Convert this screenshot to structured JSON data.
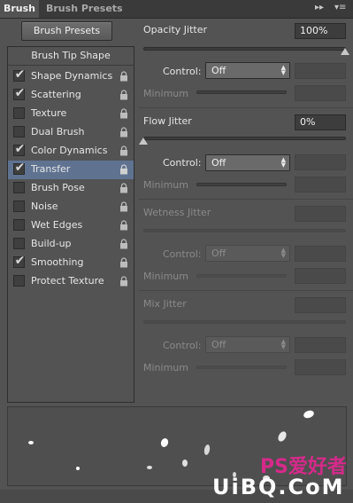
{
  "tabs": [
    {
      "label": "Brush",
      "active": true
    },
    {
      "label": "Brush Presets",
      "active": false
    }
  ],
  "tab_controls": {
    "collapse": "▸▸",
    "menu": "▾≡"
  },
  "brush_presets_button": "Brush Presets",
  "brush_tip_shape": "Brush Tip Shape",
  "options": [
    {
      "label": "Shape Dynamics",
      "checked": true,
      "selected": false
    },
    {
      "label": "Scattering",
      "checked": true,
      "selected": false
    },
    {
      "label": "Texture",
      "checked": false,
      "selected": false
    },
    {
      "label": "Dual Brush",
      "checked": false,
      "selected": false
    },
    {
      "label": "Color Dynamics",
      "checked": true,
      "selected": false
    },
    {
      "label": "Transfer",
      "checked": true,
      "selected": true
    },
    {
      "label": "Brush Pose",
      "checked": false,
      "selected": false
    },
    {
      "label": "Noise",
      "checked": false,
      "selected": false
    },
    {
      "label": "Wet Edges",
      "checked": false,
      "selected": false
    },
    {
      "label": "Build-up",
      "checked": false,
      "selected": false
    },
    {
      "label": "Smoothing",
      "checked": true,
      "selected": false
    },
    {
      "label": "Protect Texture",
      "checked": false,
      "selected": false
    }
  ],
  "opacity": {
    "label": "Opacity Jitter",
    "value": "100%",
    "slider_fraction": 1.0,
    "control_label": "Control:",
    "control_value": "Off",
    "minimum_label": "Minimum"
  },
  "flow": {
    "label": "Flow Jitter",
    "value": "0%",
    "slider_fraction": 0.0,
    "control_label": "Control:",
    "control_value": "Off",
    "minimum_label": "Minimum"
  },
  "wetness": {
    "label": "Wetness Jitter",
    "control_label": "Control:",
    "control_value": "Off",
    "minimum_label": "Minimum"
  },
  "mix": {
    "label": "Mix Jitter",
    "control_label": "Control:",
    "control_value": "Off",
    "minimum_label": "Minimum"
  },
  "watermark": {
    "line1": "PS爱好者",
    "line2": "UiBQ.CoM"
  },
  "colors": {
    "panel": "#535353",
    "selected_row": "#5f7391",
    "watermark_pink": "#d52a8a"
  }
}
